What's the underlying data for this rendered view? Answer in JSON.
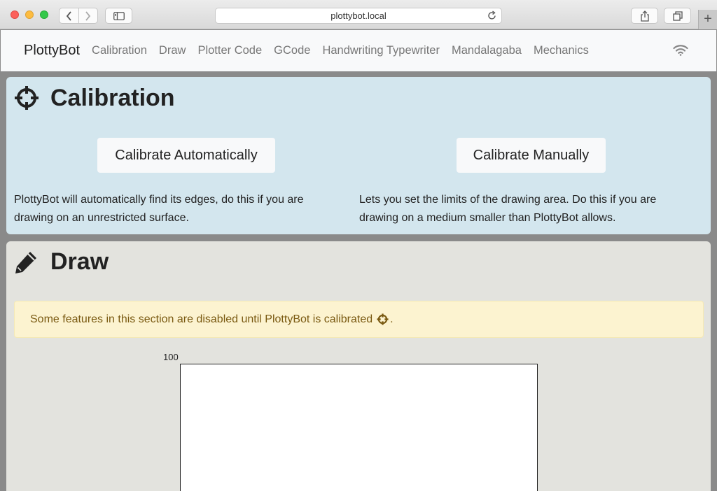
{
  "browser": {
    "url": "plottybot.local",
    "new_tab_label": "+"
  },
  "navbar": {
    "brand": "PlottyBot",
    "links": [
      "Calibration",
      "Draw",
      "Plotter Code",
      "GCode",
      "Handwriting Typewriter",
      "Mandalagaba",
      "Mechanics"
    ]
  },
  "calibration": {
    "title": "Calibration",
    "auto_button": "Calibrate Automatically",
    "manual_button": "Calibrate Manually",
    "auto_desc": "PlottyBot will automatically find its edges, do this if you are drawing on an unrestricted surface.",
    "manual_desc": "Lets you set the limits of the drawing area. Do this if you are drawing on a medium smaller than PlottyBot allows."
  },
  "draw": {
    "title": "Draw",
    "alert_text": "Some features in this section are disabled until PlottyBot is calibrated",
    "alert_suffix": ".",
    "axis_max_label": "100"
  },
  "colors": {
    "calibration_bg": "#d3e6ee",
    "draw_bg": "#e3e3de",
    "alert_bg": "#fcf3d0",
    "alert_text": "#7a5a12"
  }
}
